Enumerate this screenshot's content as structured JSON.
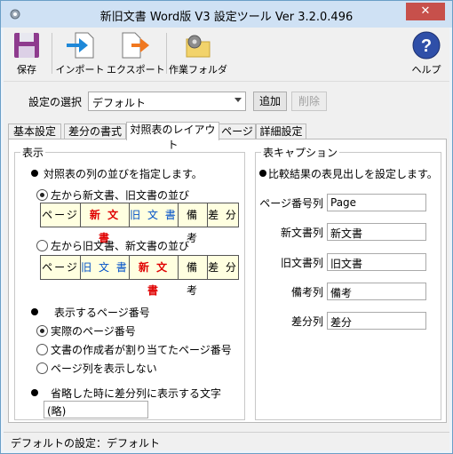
{
  "window": {
    "title": "新旧文書 Word版 V3 設定ツール Ver 3.2.0.496",
    "close_label": "✕"
  },
  "toolbar": {
    "save_label": "保存",
    "import_label": "インポート",
    "export_label": "エクスポート",
    "workfolder_label": "作業フォルダ",
    "help_label": "ヘルプ"
  },
  "settings": {
    "select_label": "設定の選択",
    "selected_value": "デフォルト",
    "add_label": "追加",
    "delete_label": "削除"
  },
  "tabs": [
    "基本設定",
    "差分の書式",
    "対照表のレイアウト",
    "ページ",
    "詳細設定"
  ],
  "display": {
    "group_title": "表示",
    "column_order_heading": "対照表の列の並びを指定します。",
    "option1_label": "左から新文書、旧文書の並び",
    "option1_cells": [
      "ページ",
      "新 文 書",
      "旧 文 書",
      "備 考",
      "差 分"
    ],
    "option2_label": "左から旧文書、新文書の並び",
    "option2_cells": [
      "ページ",
      "旧 文 書",
      "新 文 書",
      "備 考",
      "差 分"
    ],
    "page_number_heading": "表示するページ番号",
    "page_options": [
      "実際のページ番号",
      "文書の作成者が割り当てたページ番号",
      "ページ列を表示しない"
    ],
    "omit_heading": "省略した時に差分列に表示する文字",
    "omit_value": "(略)"
  },
  "caption": {
    "group_title": "表キャプション",
    "heading": "比較結果の表見出しを設定します。",
    "fields": [
      {
        "label": "ページ番号列",
        "value": "Page"
      },
      {
        "label": "新文書列",
        "value": "新文書"
      },
      {
        "label": "旧文書列",
        "value": "旧文書"
      },
      {
        "label": "備考列",
        "value": "備考"
      },
      {
        "label": "差分列",
        "value": "差分"
      }
    ]
  },
  "status_text": "デフォルトの設定：デフォルト",
  "colors": {
    "cell_bg": "#ffffe0",
    "new_doc": "#e00000",
    "old_doc": "#0050c8"
  }
}
